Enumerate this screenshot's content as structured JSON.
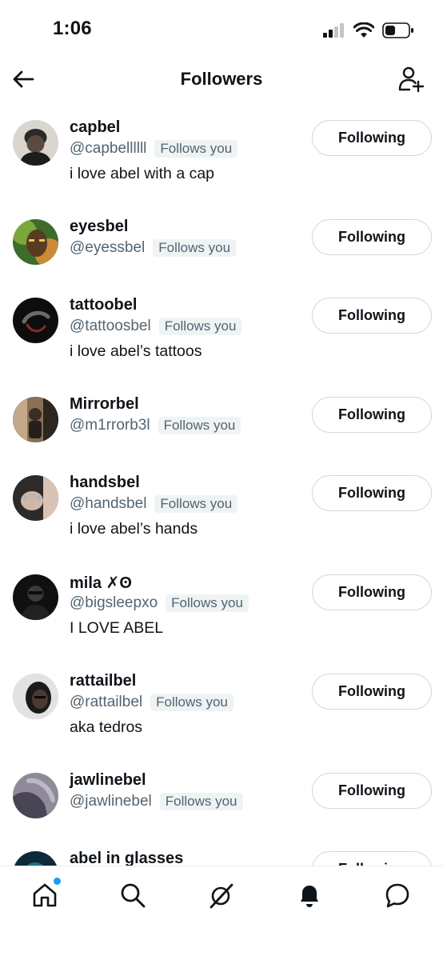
{
  "status_bar": {
    "time": "1:06",
    "icons": [
      "cellular-signal-icon",
      "wifi-icon",
      "battery-icon"
    ]
  },
  "header": {
    "title": "Followers",
    "back_icon": "arrow-left-icon",
    "add_icon": "add-user-icon"
  },
  "follower_badge": "Follows you",
  "button_label": "Following",
  "followers": [
    {
      "name": "capbel",
      "handle": "@capbellllll",
      "bio": "i love abel with a cap",
      "avatar_colors": [
        "#2a2a2a",
        "#d9d5cf"
      ]
    },
    {
      "name": "eyesbel",
      "handle": "@eyessbel",
      "bio": "",
      "avatar_colors": [
        "#3d6b2a",
        "#c98a3a"
      ]
    },
    {
      "name": "tattoobel",
      "handle": "@tattoosbel",
      "bio": "i love abel’s tattoos",
      "avatar_colors": [
        "#0d0d0d",
        "#8a2a2a"
      ]
    },
    {
      "name": "Mirrorbel",
      "handle": "@m1rrorb3l",
      "bio": "",
      "avatar_colors": [
        "#8a6e55",
        "#2c2620"
      ]
    },
    {
      "name": "handsbel",
      "handle": "@handsbel",
      "bio": "i love abel’s hands",
      "avatar_colors": [
        "#2f2a2a",
        "#d8c3b5"
      ]
    },
    {
      "name": "mila ✗ʘ",
      "handle": "@bigsleepxo",
      "bio": "I LOVE ABEL",
      "avatar_colors": [
        "#101010",
        "#3a3a3a"
      ]
    },
    {
      "name": "rattailbel",
      "handle": "@rattailbel",
      "bio": "aka tedros",
      "avatar_colors": [
        "#1a1a1a",
        "#c9c9c9"
      ]
    },
    {
      "name": "jawlinebel",
      "handle": "@jawlinebel",
      "bio": "",
      "avatar_colors": [
        "#4a4555",
        "#8e8a99"
      ]
    },
    {
      "name": "abel in glasses",
      "handle": "",
      "bio": "",
      "avatar_colors": [
        "#0e2a3a",
        "#1e6f8a"
      ]
    }
  ],
  "bottom_nav": [
    {
      "name": "home-icon",
      "active": true
    },
    {
      "name": "search-icon",
      "active": false
    },
    {
      "name": "grok-icon",
      "active": false
    },
    {
      "name": "bell-icon",
      "active": false
    },
    {
      "name": "messages-icon",
      "active": false
    }
  ],
  "colors": {
    "accent": "#1d9bf0",
    "text_primary": "#0f1419",
    "text_secondary": "#536471",
    "badge_bg": "#eff3f4",
    "button_border": "#cfd9de"
  }
}
